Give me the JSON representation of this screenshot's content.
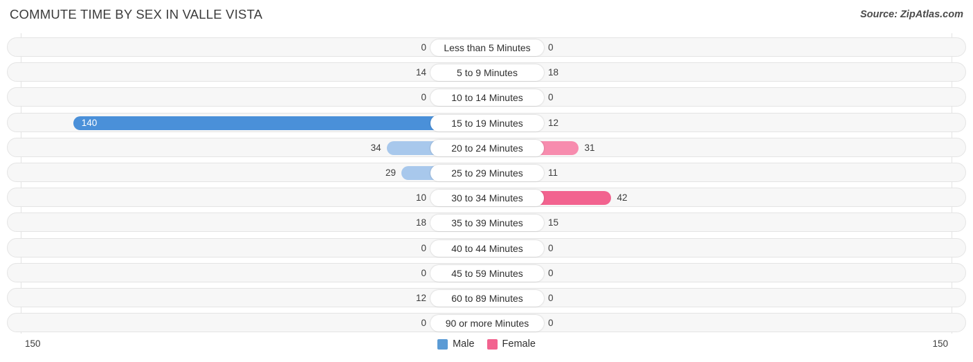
{
  "header": {
    "title": "COMMUTE TIME BY SEX IN VALLE VISTA",
    "source": "Source: ZipAtlas.com"
  },
  "footer": {
    "axis_left": "150",
    "axis_right": "150",
    "legend": [
      {
        "label": "Male",
        "color": "#5b9bd5"
      },
      {
        "label": "Female",
        "color": "#f2638f"
      }
    ]
  },
  "colors": {
    "male_max": "#4a90d9",
    "male_mid": "#7fb1e2",
    "male_min": "#a8c8ec",
    "female_max": "#f2638f",
    "female_mid": "#f78cae",
    "female_min": "#f9b4cb",
    "track": "#f7f7f7",
    "grid": "#e2e2e2"
  },
  "chart_data": {
    "type": "bar",
    "orientation": "horizontal",
    "style": "diverging-bidirectional",
    "title": "COMMUTE TIME BY SEX IN VALLE VISTA",
    "xlabel": "",
    "ylabel": "",
    "xlim": [
      150,
      150
    ],
    "axis_left_max": 150,
    "axis_right_max": 150,
    "grid": true,
    "legend_position": "bottom-center",
    "categories": [
      "Less than 5 Minutes",
      "5 to 9 Minutes",
      "10 to 14 Minutes",
      "15 to 19 Minutes",
      "20 to 24 Minutes",
      "25 to 29 Minutes",
      "30 to 34 Minutes",
      "35 to 39 Minutes",
      "40 to 44 Minutes",
      "45 to 59 Minutes",
      "60 to 89 Minutes",
      "90 or more Minutes"
    ],
    "series": [
      {
        "name": "Male",
        "color": "#5b9bd5",
        "values": [
          0,
          14,
          0,
          140,
          34,
          29,
          10,
          18,
          0,
          0,
          12,
          0
        ]
      },
      {
        "name": "Female",
        "color": "#f2638f",
        "values": [
          0,
          18,
          0,
          12,
          31,
          11,
          42,
          15,
          0,
          0,
          0,
          0
        ]
      }
    ]
  }
}
